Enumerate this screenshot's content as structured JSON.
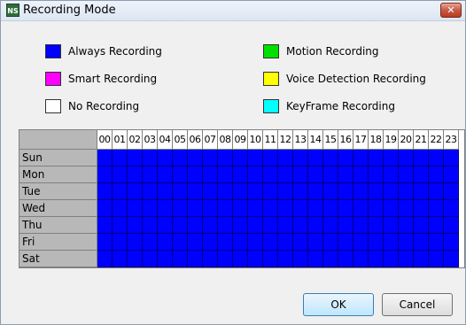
{
  "window": {
    "title": "Recording Mode",
    "close_label": "✕"
  },
  "legend": [
    {
      "label": "Always Recording",
      "color": "#0000ff"
    },
    {
      "label": "Motion Recording",
      "color": "#00e000"
    },
    {
      "label": "Smart Recording",
      "color": "#ff00ff"
    },
    {
      "label": "Voice Detection Recording",
      "color": "#ffff00"
    },
    {
      "label": "No Recording",
      "color": "#ffffff"
    },
    {
      "label": "KeyFrame Recording",
      "color": "#00ffff"
    }
  ],
  "schedule": {
    "hours": [
      "00",
      "01",
      "02",
      "03",
      "04",
      "05",
      "06",
      "07",
      "08",
      "09",
      "10",
      "11",
      "12",
      "13",
      "14",
      "15",
      "16",
      "17",
      "18",
      "19",
      "20",
      "21",
      "22",
      "23"
    ],
    "days": [
      "Sun",
      "Mon",
      "Tue",
      "Wed",
      "Thu",
      "Fri",
      "Sat"
    ],
    "cell_mode": "Always Recording",
    "cell_color": "#0000ff"
  },
  "buttons": {
    "ok": "OK",
    "cancel": "Cancel"
  }
}
